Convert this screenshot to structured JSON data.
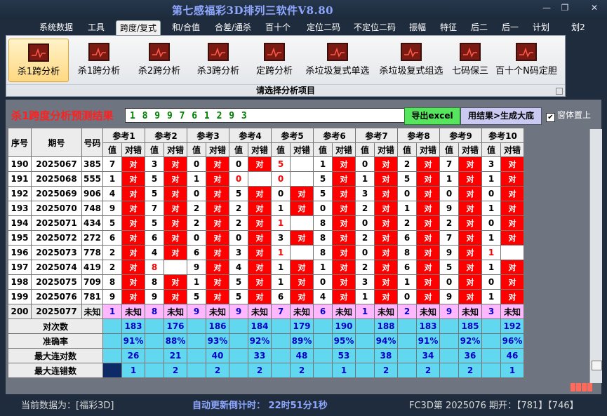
{
  "window": {
    "title": "第七感福彩3D排列三软件V8.80",
    "controls": [
      "—",
      "❐",
      "✕"
    ]
  },
  "menu": [
    "系统数据",
    "工具",
    "跨度/复式",
    "和/合值",
    "合差/通杀",
    "百十个",
    "定位二码",
    "不定位二码",
    "振幅",
    "特征",
    "后二",
    "后一",
    "计划",
    "划2"
  ],
  "menu_active": 2,
  "ribbon": {
    "buttons": [
      "杀1跨分析",
      "杀1跨分析",
      "杀2跨分析",
      "杀3跨分析",
      "定跨分析",
      "杀垃圾复式单选",
      "杀垃圾复式组选",
      "七码保三",
      "百十个N码定胆"
    ],
    "active": 0,
    "group_label": "请选择分析项目",
    "icon": "chart-icon"
  },
  "result": {
    "title": "杀1跨度分析预测结果",
    "value": "1 8 9 9 7 6 1 2 9 3",
    "export_button": "导出excel",
    "generate_button": "用结果>生成大底",
    "topmost_label": "窗体置上",
    "topmost_checked": true
  },
  "table": {
    "headers": {
      "seq": "序号",
      "period": "期号",
      "code": "号码"
    },
    "refs": [
      "参考1",
      "参考2",
      "参考3",
      "参考4",
      "参考5",
      "参考6",
      "参考7",
      "参考8",
      "参考9",
      "参考10"
    ],
    "sub_headers": {
      "value": "值",
      "result": "对错"
    },
    "result_text": "对",
    "unknown_text": "未知",
    "rows": [
      {
        "seq": "190",
        "period": "2025067",
        "code": "385",
        "v": [
          "7",
          "3",
          "0",
          "0",
          "5",
          "1",
          "0",
          "2",
          "7",
          "3"
        ],
        "ok": [
          1,
          1,
          1,
          1,
          0,
          1,
          1,
          1,
          1,
          1
        ]
      },
      {
        "seq": "191",
        "period": "2025068",
        "code": "555",
        "v": [
          "1",
          "5",
          "1",
          "0",
          "0",
          "5",
          "1",
          "5",
          "1",
          "1"
        ],
        "ok": [
          1,
          1,
          1,
          0,
          0,
          1,
          1,
          1,
          1,
          1
        ]
      },
      {
        "seq": "192",
        "period": "2025069",
        "code": "906",
        "v": [
          "4",
          "5",
          "0",
          "5",
          "0",
          "5",
          "3",
          "0",
          "0",
          "0"
        ],
        "ok": [
          1,
          1,
          1,
          1,
          1,
          1,
          1,
          1,
          1,
          1
        ]
      },
      {
        "seq": "193",
        "period": "2025070",
        "code": "748",
        "v": [
          "9",
          "7",
          "2",
          "2",
          "1",
          "0",
          "2",
          "1",
          "9",
          "1"
        ],
        "ok": [
          1,
          1,
          1,
          1,
          1,
          1,
          1,
          1,
          1,
          1
        ]
      },
      {
        "seq": "194",
        "period": "2025071",
        "code": "434",
        "v": [
          "5",
          "5",
          "2",
          "2",
          "1",
          "8",
          "0",
          "2",
          "2",
          "0"
        ],
        "ok": [
          1,
          1,
          1,
          1,
          0,
          1,
          1,
          1,
          1,
          1
        ]
      },
      {
        "seq": "195",
        "period": "2025072",
        "code": "272",
        "v": [
          "6",
          "6",
          "0",
          "0",
          "3",
          "8",
          "2",
          "6",
          "7",
          "1"
        ],
        "ok": [
          1,
          1,
          1,
          1,
          1,
          1,
          1,
          1,
          1,
          1
        ]
      },
      {
        "seq": "196",
        "period": "2025073",
        "code": "778",
        "v": [
          "2",
          "4",
          "6",
          "3",
          "1",
          "8",
          "0",
          "8",
          "9",
          "1"
        ],
        "ok": [
          1,
          1,
          1,
          1,
          0,
          1,
          1,
          1,
          1,
          0
        ]
      },
      {
        "seq": "197",
        "period": "2025074",
        "code": "419",
        "v": [
          "2",
          "8",
          "9",
          "4",
          "1",
          "1",
          "2",
          "6",
          "5",
          "1"
        ],
        "ok": [
          1,
          0,
          1,
          1,
          1,
          1,
          1,
          1,
          1,
          1
        ]
      },
      {
        "seq": "198",
        "period": "2025075",
        "code": "709",
        "v": [
          "8",
          "8",
          "1",
          "5",
          "1",
          "0",
          "3",
          "1",
          "0",
          "0"
        ],
        "ok": [
          1,
          1,
          1,
          1,
          1,
          1,
          1,
          1,
          1,
          1
        ]
      },
      {
        "seq": "199",
        "period": "2025076",
        "code": "781",
        "v": [
          "9",
          "9",
          "5",
          "5",
          "6",
          "4",
          "1",
          "0",
          "9",
          "1"
        ],
        "ok": [
          1,
          1,
          1,
          1,
          1,
          1,
          1,
          1,
          1,
          1
        ]
      }
    ],
    "red_value_cells": [
      [
        0,
        4
      ],
      [
        1,
        3
      ],
      [
        1,
        4
      ],
      [
        4,
        4
      ],
      [
        6,
        4
      ],
      [
        6,
        9
      ],
      [
        7,
        1
      ]
    ],
    "pending": {
      "seq": "200",
      "period": "2025077",
      "code": "未知",
      "v": [
        "1",
        "8",
        "9",
        "9",
        "7",
        "6",
        "1",
        "2",
        "9",
        "3"
      ]
    },
    "stats": [
      {
        "label": "对次数",
        "values": [
          "183",
          "176",
          "186",
          "184",
          "179",
          "190",
          "188",
          "183",
          "185",
          "192"
        ]
      },
      {
        "label": "准确率",
        "values": [
          "91%",
          "88%",
          "93%",
          "92%",
          "89%",
          "95%",
          "94%",
          "91%",
          "92%",
          "96%"
        ]
      },
      {
        "label": "最大连对数",
        "values": [
          "26",
          "21",
          "40",
          "33",
          "48",
          "53",
          "38",
          "34",
          "36",
          "46"
        ]
      },
      {
        "label": "最大连错数",
        "values": [
          "1",
          "2",
          "2",
          "2",
          "2",
          "1",
          "2",
          "2",
          "2",
          "1"
        ]
      }
    ]
  },
  "status": {
    "current": "当前数据为：[福彩3D]",
    "countdown": "自动更新倒计时：  22时51分1秒",
    "draw": "FC3D第 2025076 期开：【781】【746】"
  }
}
